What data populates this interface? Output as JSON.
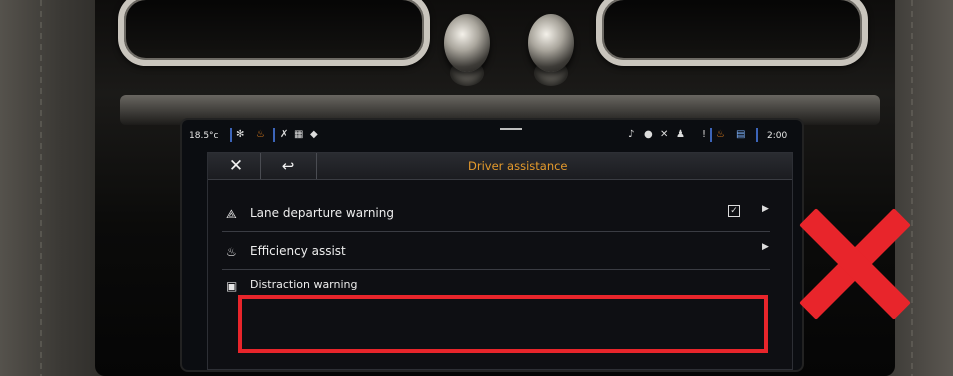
{
  "status_bar": {
    "temperature": "18.5°c",
    "clock": "2:00",
    "icons": [
      "fan-icon",
      "seat-heating-icon",
      "phone-off-icon",
      "grid-icon",
      "cube-icon",
      "sound-icon",
      "record-icon",
      "signal-icon",
      "person-icon",
      "alert-icon",
      "seat-icon",
      "media-icon"
    ]
  },
  "dialog": {
    "title": "Driver assistance",
    "close_glyph": "✕",
    "back_glyph": "↩",
    "items": [
      {
        "label": "Lane departure warning",
        "icon": "lane-departure-icon",
        "checked": true,
        "has_arrow": true
      },
      {
        "label": "Efficiency assist",
        "icon": "efficiency-icon",
        "checked": false,
        "has_arrow": true
      },
      {
        "label": "Distraction warning",
        "icon": "distraction-icon",
        "checked": false,
        "has_arrow": false
      }
    ]
  },
  "colors": {
    "accent": "#e49a2c",
    "highlight": "#e8252b",
    "screen_bg": "#0b0d11"
  }
}
